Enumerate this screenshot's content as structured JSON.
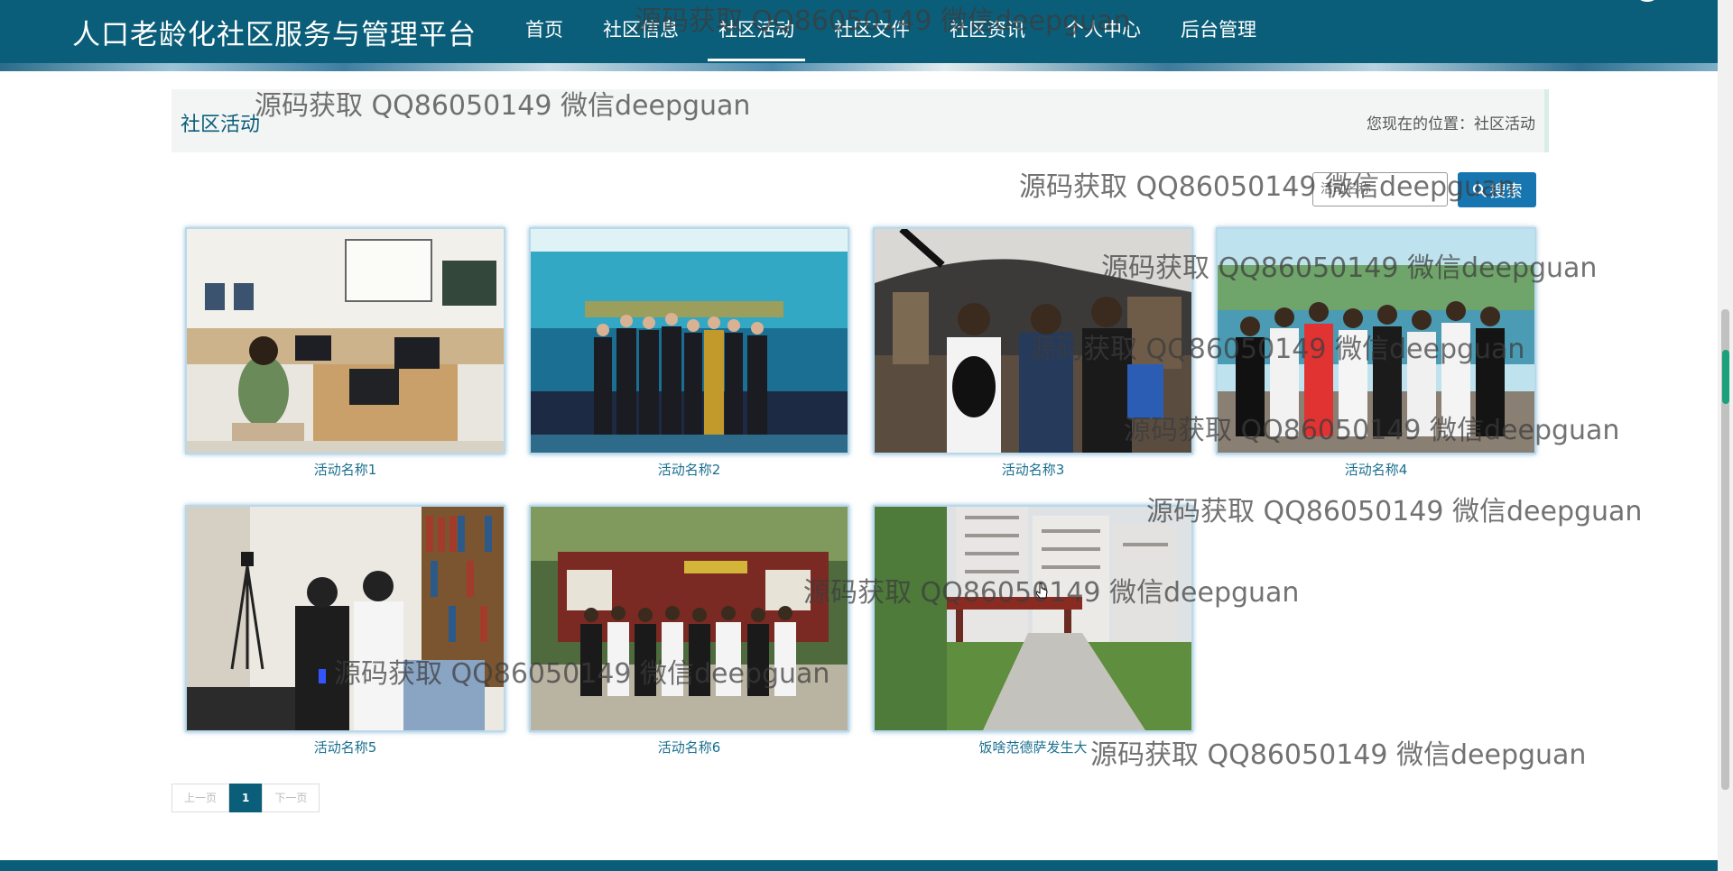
{
  "site": {
    "title": "人口老龄化社区服务与管理平台"
  },
  "nav": {
    "items": [
      {
        "label": "首页"
      },
      {
        "label": "社区信息"
      },
      {
        "label": "社区活动"
      },
      {
        "label": "社区文件"
      },
      {
        "label": "社区资讯"
      },
      {
        "label": "个人中心"
      },
      {
        "label": "后台管理"
      }
    ],
    "active": "社区活动"
  },
  "section": {
    "title": "社区活动",
    "breadcrumb_prefix": "您现在的位置：",
    "breadcrumb_current": "社区活动"
  },
  "search": {
    "placeholder": "活动名称",
    "button_label": "搜索",
    "button_icon": "search-icon"
  },
  "activities": [
    {
      "name": "活动名称1",
      "image": "computer-classroom-photo"
    },
    {
      "name": "活动名称2",
      "image": "conference-group-photo"
    },
    {
      "name": "活动名称3",
      "image": "young-men-at-pavilion-photo"
    },
    {
      "name": "活动名称4",
      "image": "group-by-lake-photo"
    },
    {
      "name": "活动名称5",
      "image": "library-demo-photo"
    },
    {
      "name": "活动名称6",
      "image": "group-at-temple-photo"
    },
    {
      "name": "饭啥范德萨发生大",
      "image": "residential-garden-photo"
    }
  ],
  "pagination": {
    "prev": "上一页",
    "current": "1",
    "next": "下一页"
  },
  "watermark": "源码获取 QQ86050149 微信deepguan",
  "colors": {
    "header": "#0b5e79",
    "accent": "#1776b0",
    "caption": "#1a6f8f",
    "card_border": "#b9d9ea"
  }
}
